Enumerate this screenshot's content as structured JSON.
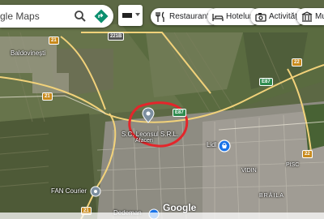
{
  "search": {
    "query_text": "gle Maps"
  },
  "chips": [
    {
      "label": "Restaurante",
      "icon": "fork-knife-icon"
    },
    {
      "label": "Hoteluri",
      "icon": "bed-icon"
    },
    {
      "label": "Activități",
      "icon": "camera-icon"
    },
    {
      "label": "Muzee",
      "icon": "museum-icon"
    }
  ],
  "places": {
    "baldovinesti": "Baldovinești",
    "vidin": "VIDIN",
    "pisc": "PISC",
    "braila": "BRĂILA",
    "business": "S.C. Leonsul S.R.L.",
    "business_sub": "Afaceri",
    "lidl": "Lidl",
    "fan_courier": "FAN Courier",
    "dedeman": "Dedeman"
  },
  "road_badges": [
    "221B",
    "E87",
    "E87",
    "21",
    "21",
    "21",
    "22",
    "22"
  ],
  "attribution": {
    "logo": "Google"
  },
  "colors": {
    "annotation": "#e3262b",
    "pin_grey": "#7d8fa0",
    "pin_blue": "#1a73e8"
  }
}
